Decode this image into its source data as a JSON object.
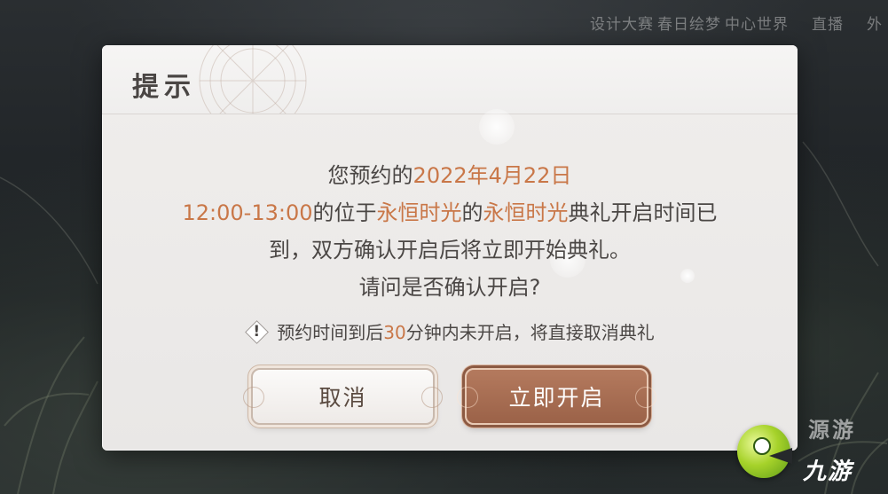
{
  "topbar": {
    "items": [
      "设计大赛",
      "春日绘梦",
      "中心世界",
      "直播",
      "外"
    ]
  },
  "dialog": {
    "title": "提示",
    "message": {
      "line1_pre": "您预约的",
      "line1_date": "2022年4月22日",
      "line2_time": "12:00-13:00",
      "line2_a": "的位于",
      "line2_place": "永恒时光",
      "line2_b": "的",
      "line2_event": "永恒时光",
      "line2_c": "典礼开启时间已",
      "line3": "到，双方确认开启后将立即开始典礼。",
      "line4": "请问是否确认开启?"
    },
    "warning": {
      "icon": "!",
      "pre": "预约时间到后",
      "minutes": "30",
      "post": "分钟内未开启，将直接取消典礼"
    },
    "buttons": {
      "cancel_label": "取消",
      "confirm_label": "立即开启"
    }
  },
  "watermark": {
    "top_text": "源游",
    "brand_text": "九游"
  },
  "colors": {
    "highlight": "#c97748",
    "confirm_button": "#a86c51",
    "text": "#4b4745"
  }
}
